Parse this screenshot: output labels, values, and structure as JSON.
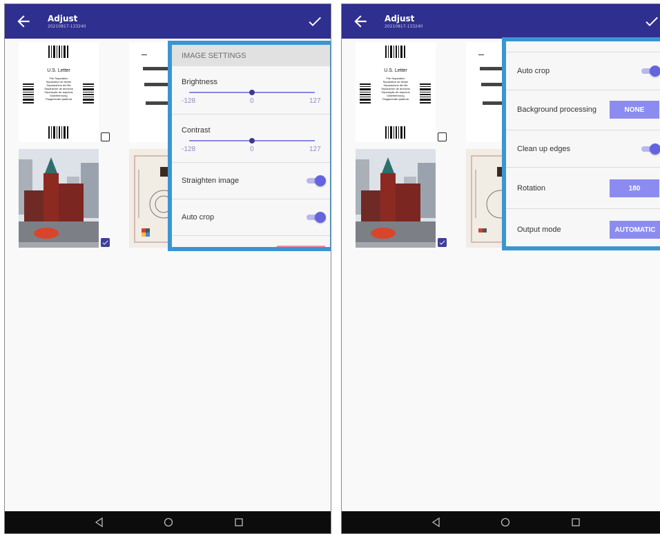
{
  "colors": {
    "appbar": "#2f2f8f",
    "highlight_border": "#3a96d2",
    "accent": "#6464e0",
    "button_bg": "#8c8cf0",
    "navbar": "#0c0c0c"
  },
  "left": {
    "appbar": {
      "title": "Adjust",
      "subtitle": "20210817-133240"
    },
    "thumb1": {
      "heading": "U.S. Letter",
      "lines": [
        "File Separation",
        "Separation de fichier",
        "Separazione dei file",
        "Separación de archivos",
        "Seperação de arquivos",
        "Dateitrennung",
        "Разделение файлов"
      ],
      "checked": false
    },
    "thumb3": {
      "checked": true
    },
    "panel": {
      "header": "IMAGE SETTINGS",
      "brightness": {
        "label": "Brightness",
        "min": "-128",
        "mid": "0",
        "max": "127",
        "value": 0
      },
      "contrast": {
        "label": "Contrast",
        "min": "-128",
        "mid": "0",
        "max": "127",
        "value": 0
      },
      "straighten": {
        "label": "Straighten image",
        "on": true
      },
      "autocrop": {
        "label": "Auto crop",
        "on": true
      }
    }
  },
  "right": {
    "appbar": {
      "title": "Adjust",
      "subtitle": "20210817-133240"
    },
    "thumb1": {
      "heading": "U.S. Letter",
      "lines": [
        "File Separation",
        "Separation de fichier",
        "Separazione dei file",
        "Separación de archivos",
        "Seperação de arquivos",
        "Dateitrennung",
        "Разделение файлов"
      ],
      "checked": false
    },
    "thumb3": {
      "checked": true
    },
    "panel": {
      "autocrop": {
        "label": "Auto crop",
        "on": true
      },
      "background": {
        "label": "Background processing",
        "value": "NONE"
      },
      "cleanup": {
        "label": "Clean up edges",
        "on": true
      },
      "rotation": {
        "label": "Rotation",
        "value": "180"
      },
      "output": {
        "label": "Output mode",
        "value": "AUTOMATIC"
      }
    }
  },
  "icons": [
    "back-arrow-icon",
    "check-icon",
    "nav-back-icon",
    "nav-home-icon",
    "nav-recents-icon",
    "checkbox-check-icon"
  ]
}
